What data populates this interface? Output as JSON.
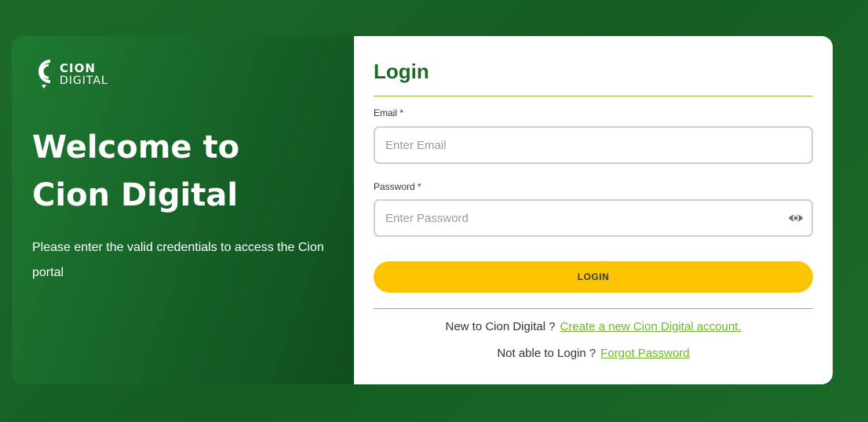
{
  "brand": {
    "logo_line1": "CION",
    "logo_line2": "DIGITAL"
  },
  "left": {
    "welcome_line1": "Welcome to",
    "welcome_line2": "Cion Digital",
    "subtitle": "Please enter the valid credentials to access the Cion portal"
  },
  "form": {
    "title": "Login",
    "email_label": "Email *",
    "email_placeholder": "Enter Email",
    "email_value": "",
    "password_label": "Password *",
    "password_placeholder": "Enter Password",
    "password_value": "",
    "login_button": "LOGIN"
  },
  "footer": {
    "new_prompt": "New to Cion Digital ?",
    "create_link": "Create a new Cion Digital account.",
    "forgot_prompt": "Not able to Login ?",
    "forgot_link": "Forgot Password"
  },
  "icons": {
    "logo": "cion-logo-icon",
    "password_toggle": "eye-icon"
  },
  "colors": {
    "brand_green": "#1b6a2a",
    "accent_lime": "#6fb52c",
    "button_yellow": "#fdc500"
  }
}
